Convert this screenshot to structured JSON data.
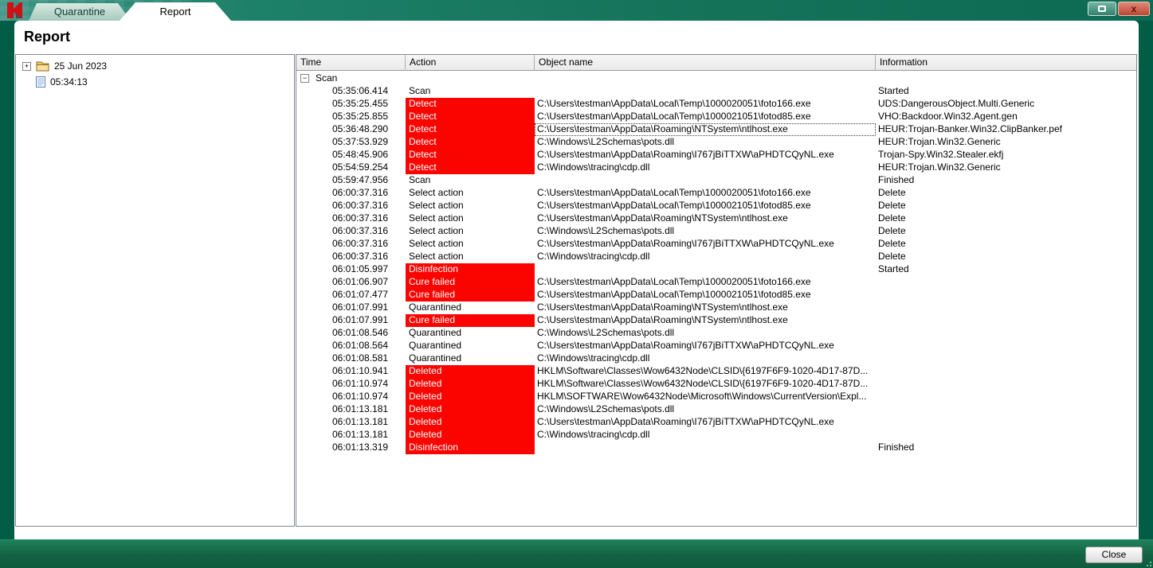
{
  "window": {
    "tabs": [
      {
        "label": "Quarantine",
        "active": false
      },
      {
        "label": "Report",
        "active": true
      }
    ],
    "controls": {
      "close_glyph": "x"
    }
  },
  "page_title": "Report",
  "tree": {
    "items": [
      {
        "label": "25 Jun 2023",
        "icon": "folder-icon",
        "expander": "+"
      },
      {
        "label": "05:34:13",
        "icon": "document-icon"
      }
    ]
  },
  "table": {
    "columns": [
      "Time",
      "Action",
      "Object name",
      "Information"
    ],
    "group": {
      "label": "Scan",
      "expander": "−"
    },
    "rows": [
      {
        "time": "05:35:06.414",
        "action": "Scan",
        "object": "",
        "info": "Started",
        "red": false
      },
      {
        "time": "05:35:25.455",
        "action": "Detect",
        "object": "C:\\Users\\testman\\AppData\\Local\\Temp\\1000020051\\foto166.exe",
        "info": "UDS:DangerousObject.Multi.Generic",
        "red": true
      },
      {
        "time": "05:35:25.855",
        "action": "Detect",
        "object": "C:\\Users\\testman\\AppData\\Local\\Temp\\1000021051\\fotod85.exe",
        "info": "VHO:Backdoor.Win32.Agent.gen",
        "red": true
      },
      {
        "time": "05:36:48.290",
        "action": "Detect",
        "object": "C:\\Users\\testman\\AppData\\Roaming\\NTSystem\\ntlhost.exe",
        "info": "HEUR:Trojan-Banker.Win32.ClipBanker.pef",
        "red": true,
        "focused": true
      },
      {
        "time": "05:37:53.929",
        "action": "Detect",
        "object": "C:\\Windows\\L2Schemas\\pots.dll",
        "info": "HEUR:Trojan.Win32.Generic",
        "red": true
      },
      {
        "time": "05:48:45.906",
        "action": "Detect",
        "object": "C:\\Users\\testman\\AppData\\Roaming\\I767jBiTTXW\\aPHDTCQyNL.exe",
        "info": "Trojan-Spy.Win32.Stealer.ekfj",
        "red": true
      },
      {
        "time": "05:54:59.254",
        "action": "Detect",
        "object": "C:\\Windows\\tracing\\cdp.dll",
        "info": "HEUR:Trojan.Win32.Generic",
        "red": true
      },
      {
        "time": "05:59:47.956",
        "action": "Scan",
        "object": "",
        "info": "Finished",
        "red": false
      },
      {
        "time": "06:00:37.316",
        "action": "Select action",
        "object": "C:\\Users\\testman\\AppData\\Local\\Temp\\1000020051\\foto166.exe",
        "info": "Delete",
        "red": false
      },
      {
        "time": "06:00:37.316",
        "action": "Select action",
        "object": "C:\\Users\\testman\\AppData\\Local\\Temp\\1000021051\\fotod85.exe",
        "info": "Delete",
        "red": false
      },
      {
        "time": "06:00:37.316",
        "action": "Select action",
        "object": "C:\\Users\\testman\\AppData\\Roaming\\NTSystem\\ntlhost.exe",
        "info": "Delete",
        "red": false
      },
      {
        "time": "06:00:37.316",
        "action": "Select action",
        "object": "C:\\Windows\\L2Schemas\\pots.dll",
        "info": "Delete",
        "red": false
      },
      {
        "time": "06:00:37.316",
        "action": "Select action",
        "object": "C:\\Users\\testman\\AppData\\Roaming\\I767jBiTTXW\\aPHDTCQyNL.exe",
        "info": "Delete",
        "red": false
      },
      {
        "time": "06:00:37.316",
        "action": "Select action",
        "object": "C:\\Windows\\tracing\\cdp.dll",
        "info": "Delete",
        "red": false
      },
      {
        "time": "06:01:05.997",
        "action": "Disinfection",
        "object": "",
        "info": "Started",
        "red": true
      },
      {
        "time": "06:01:06.907",
        "action": "Cure failed",
        "object": "C:\\Users\\testman\\AppData\\Local\\Temp\\1000020051\\foto166.exe",
        "info": "",
        "red": true
      },
      {
        "time": "06:01:07.477",
        "action": "Cure failed",
        "object": "C:\\Users\\testman\\AppData\\Local\\Temp\\1000021051\\fotod85.exe",
        "info": "",
        "red": true
      },
      {
        "time": "06:01:07.991",
        "action": "Quarantined",
        "object": "C:\\Users\\testman\\AppData\\Roaming\\NTSystem\\ntlhost.exe",
        "info": "",
        "red": false
      },
      {
        "time": "06:01:07.991",
        "action": "Cure failed",
        "object": "C:\\Users\\testman\\AppData\\Roaming\\NTSystem\\ntlhost.exe",
        "info": "",
        "red": true
      },
      {
        "time": "06:01:08.546",
        "action": "Quarantined",
        "object": "C:\\Windows\\L2Schemas\\pots.dll",
        "info": "",
        "red": false
      },
      {
        "time": "06:01:08.564",
        "action": "Quarantined",
        "object": "C:\\Users\\testman\\AppData\\Roaming\\I767jBiTTXW\\aPHDTCQyNL.exe",
        "info": "",
        "red": false
      },
      {
        "time": "06:01:08.581",
        "action": "Quarantined",
        "object": "C:\\Windows\\tracing\\cdp.dll",
        "info": "",
        "red": false
      },
      {
        "time": "06:01:10.941",
        "action": "Deleted",
        "object": "HKLM\\Software\\Classes\\Wow6432Node\\CLSID\\{6197F6F9-1020-4D17-87D...",
        "info": "",
        "red": true
      },
      {
        "time": "06:01:10.974",
        "action": "Deleted",
        "object": "HKLM\\Software\\Classes\\Wow6432Node\\CLSID\\{6197F6F9-1020-4D17-87D...",
        "info": "",
        "red": true
      },
      {
        "time": "06:01:10.974",
        "action": "Deleted",
        "object": "HKLM\\SOFTWARE\\Wow6432Node\\Microsoft\\Windows\\CurrentVersion\\Expl...",
        "info": "",
        "red": true
      },
      {
        "time": "06:01:13.181",
        "action": "Deleted",
        "object": "C:\\Windows\\L2Schemas\\pots.dll",
        "info": "",
        "red": true
      },
      {
        "time": "06:01:13.181",
        "action": "Deleted",
        "object": "C:\\Users\\testman\\AppData\\Roaming\\I767jBiTTXW\\aPHDTCQyNL.exe",
        "info": "",
        "red": true
      },
      {
        "time": "06:01:13.181",
        "action": "Deleted",
        "object": "C:\\Windows\\tracing\\cdp.dll",
        "info": "",
        "red": true
      },
      {
        "time": "06:01:13.319",
        "action": "Disinfection",
        "object": "",
        "info": "Finished",
        "red": true
      }
    ]
  },
  "footer": {
    "close_label": "Close"
  },
  "colors": {
    "highlight_red": "#fb0400",
    "frame_green": "#025d47",
    "titlebar_teal": "#147359",
    "tab_inactive": "#a6cabd"
  }
}
